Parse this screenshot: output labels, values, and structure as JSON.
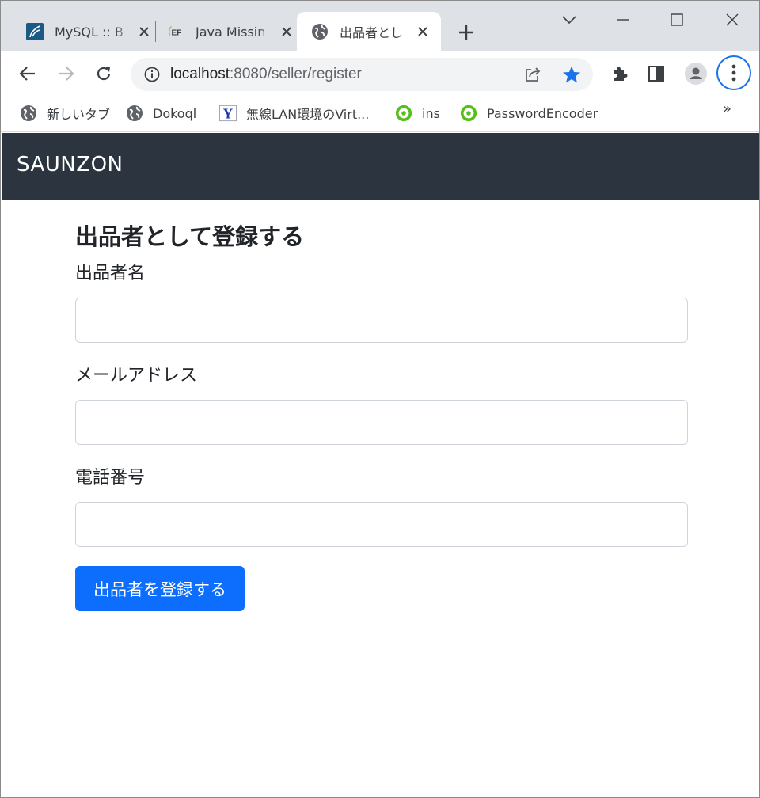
{
  "browser": {
    "tabs": [
      {
        "title": "MySQL :: B",
        "favicon": "mysql-icon",
        "active": false
      },
      {
        "title": "Java Missin",
        "favicon": "ef-icon",
        "active": false
      },
      {
        "title": "出品者とし",
        "favicon": "globe-icon",
        "active": true
      }
    ],
    "address": {
      "host": "localhost",
      "path": ":8080/seller/register"
    },
    "bookmarks": [
      {
        "label": "新しいタブ",
        "icon": "globe-icon"
      },
      {
        "label": "Dokoql",
        "icon": "globe-icon"
      },
      {
        "label": "無線LAN環境のVirt...",
        "icon": "yahoo-y-icon"
      },
      {
        "label": "ins",
        "icon": "green-ring-icon"
      },
      {
        "label": "PasswordEncoder",
        "icon": "green-ring-icon"
      }
    ],
    "bookmarks_overflow": "»",
    "colors": {
      "accent": "#1a73e8",
      "tabstrip": "#dee1e6"
    }
  },
  "app": {
    "brand": "SAUNZON",
    "navbar_color": "#2c343f"
  },
  "form": {
    "title": "出品者として登録する",
    "fields": [
      {
        "label": "出品者名",
        "value": ""
      },
      {
        "label": "メールアドレス",
        "value": ""
      },
      {
        "label": "電話番号",
        "value": ""
      }
    ],
    "submit_label": "出品者を登録する",
    "submit_color": "#0d6efd"
  }
}
